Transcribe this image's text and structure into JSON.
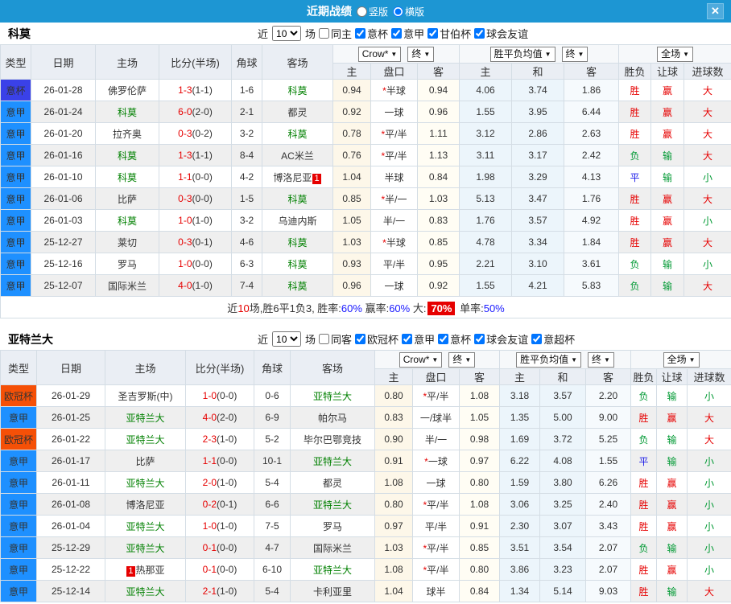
{
  "titlebar": {
    "title": "近期战绩",
    "options": [
      {
        "label": "竖版",
        "selected": false
      },
      {
        "label": "横版",
        "selected": true
      }
    ],
    "close_label": "✕"
  },
  "table": {
    "left_headers": [
      "类型",
      "日期",
      "主场",
      "比分(半场)",
      "角球",
      "客场"
    ],
    "sub_headers": [
      "主",
      "盘口",
      "客",
      "主",
      "和",
      "客",
      "胜负",
      "让球",
      "进球数"
    ],
    "dropdowns": {
      "odds": [
        "Crow*",
        "终"
      ],
      "avg": [
        "胜平负均值",
        "终"
      ],
      "scope": [
        "全场"
      ]
    }
  },
  "colors": {
    "titlebar_bg": "#1d96d3",
    "league": {
      "意甲": "#1e90ff",
      "意杯": "#3a41e8",
      "欧冠杯": "#f55007"
    },
    "outcome": {
      "胜": "#e60000",
      "平": "#1a1ae8",
      "负": "#009933",
      "赢": "#e60000",
      "输": "#009933",
      "大": "#e60000",
      "小": "#009933"
    }
  },
  "sections": [
    {
      "team": "科莫",
      "filter": {
        "prefix": "近",
        "count": "10",
        "suffix": "场",
        "toggle": {
          "label": "同主",
          "checked": false
        },
        "leagues": [
          {
            "label": "意杯",
            "checked": true
          },
          {
            "label": "意甲",
            "checked": true
          },
          {
            "label": "甘伯杯",
            "checked": true
          },
          {
            "label": "球会友谊",
            "checked": true
          }
        ]
      },
      "rows": [
        {
          "league": "意杯",
          "date": "26-01-28",
          "home": {
            "name": "佛罗伦萨"
          },
          "score": "1-3",
          "half": "(1-1)",
          "corners": "1-6",
          "away": {
            "name": "科莫",
            "focus": true
          },
          "odds": [
            "0.94",
            "*半球",
            "0.94"
          ],
          "avg": [
            "4.06",
            "3.74",
            "1.86"
          ],
          "outcome": [
            "胜",
            "赢",
            "大"
          ]
        },
        {
          "league": "意甲",
          "date": "26-01-24",
          "home": {
            "name": "科莫",
            "focus": true
          },
          "score": "6-0",
          "half": "(2-0)",
          "corners": "2-1",
          "away": {
            "name": "都灵"
          },
          "odds": [
            "0.92",
            "一球",
            "0.96"
          ],
          "avg": [
            "1.55",
            "3.95",
            "6.44"
          ],
          "outcome": [
            "胜",
            "赢",
            "大"
          ]
        },
        {
          "league": "意甲",
          "date": "26-01-20",
          "home": {
            "name": "拉齐奥"
          },
          "score": "0-3",
          "half": "(0-2)",
          "corners": "3-2",
          "away": {
            "name": "科莫",
            "focus": true
          },
          "odds": [
            "0.78",
            "*平/半",
            "1.11"
          ],
          "avg": [
            "3.12",
            "2.86",
            "2.63"
          ],
          "outcome": [
            "胜",
            "赢",
            "大"
          ]
        },
        {
          "league": "意甲",
          "date": "26-01-16",
          "home": {
            "name": "科莫",
            "focus": true
          },
          "score": "1-3",
          "half": "(1-1)",
          "corners": "8-4",
          "away": {
            "name": "AC米兰"
          },
          "odds": [
            "0.76",
            "*平/半",
            "1.13"
          ],
          "avg": [
            "3.11",
            "3.17",
            "2.42"
          ],
          "outcome": [
            "负",
            "输",
            "大"
          ]
        },
        {
          "league": "意甲",
          "date": "26-01-10",
          "home": {
            "name": "科莫",
            "focus": true
          },
          "score": "1-1",
          "half": "(0-0)",
          "corners": "4-2",
          "away": {
            "name": "博洛尼亚",
            "badge": "1",
            "badge_pos": "after"
          },
          "odds": [
            "1.04",
            "半球",
            "0.84"
          ],
          "avg": [
            "1.98",
            "3.29",
            "4.13"
          ],
          "outcome": [
            "平",
            "输",
            "小"
          ]
        },
        {
          "league": "意甲",
          "date": "26-01-06",
          "home": {
            "name": "比萨"
          },
          "score": "0-3",
          "half": "(0-0)",
          "corners": "1-5",
          "away": {
            "name": "科莫",
            "focus": true
          },
          "odds": [
            "0.85",
            "*半/一",
            "1.03"
          ],
          "avg": [
            "5.13",
            "3.47",
            "1.76"
          ],
          "outcome": [
            "胜",
            "赢",
            "大"
          ]
        },
        {
          "league": "意甲",
          "date": "26-01-03",
          "home": {
            "name": "科莫",
            "focus": true
          },
          "score": "1-0",
          "half": "(1-0)",
          "corners": "3-2",
          "away": {
            "name": "乌迪内斯"
          },
          "odds": [
            "1.05",
            "半/一",
            "0.83"
          ],
          "avg": [
            "1.76",
            "3.57",
            "4.92"
          ],
          "outcome": [
            "胜",
            "赢",
            "小"
          ]
        },
        {
          "league": "意甲",
          "date": "25-12-27",
          "home": {
            "name": "莱切"
          },
          "score": "0-3",
          "half": "(0-1)",
          "corners": "4-6",
          "away": {
            "name": "科莫",
            "focus": true
          },
          "odds": [
            "1.03",
            "*半球",
            "0.85"
          ],
          "avg": [
            "4.78",
            "3.34",
            "1.84"
          ],
          "outcome": [
            "胜",
            "赢",
            "大"
          ]
        },
        {
          "league": "意甲",
          "date": "25-12-16",
          "home": {
            "name": "罗马"
          },
          "score": "1-0",
          "half": "(0-0)",
          "corners": "6-3",
          "away": {
            "name": "科莫",
            "focus": true
          },
          "odds": [
            "0.93",
            "平/半",
            "0.95"
          ],
          "avg": [
            "2.21",
            "3.10",
            "3.61"
          ],
          "outcome": [
            "负",
            "输",
            "小"
          ]
        },
        {
          "league": "意甲",
          "date": "25-12-07",
          "home": {
            "name": "国际米兰"
          },
          "score": "4-0",
          "half": "(1-0)",
          "corners": "7-4",
          "away": {
            "name": "科莫",
            "focus": true
          },
          "odds": [
            "0.96",
            "一球",
            "0.92"
          ],
          "avg": [
            "1.55",
            "4.21",
            "5.83"
          ],
          "outcome": [
            "负",
            "输",
            "大"
          ]
        }
      ],
      "summary": [
        {
          "t": "近"
        },
        {
          "t": "10",
          "c": "red"
        },
        {
          "t": "场,胜6平1负3, 胜率:"
        },
        {
          "t": "60%",
          "c": "blue"
        },
        {
          "t": " 赢率:"
        },
        {
          "t": "60%",
          "c": "blue"
        },
        {
          "t": " 大:"
        },
        {
          "t": "70%",
          "c": "hl"
        },
        {
          "t": " 单率:"
        },
        {
          "t": "50%",
          "c": "blue"
        }
      ]
    },
    {
      "team": "亚特兰大",
      "filter": {
        "prefix": "近",
        "count": "10",
        "suffix": "场",
        "toggle": {
          "label": "同客",
          "checked": false
        },
        "leagues": [
          {
            "label": "欧冠杯",
            "checked": true
          },
          {
            "label": "意甲",
            "checked": true
          },
          {
            "label": "意杯",
            "checked": true
          },
          {
            "label": "球会友谊",
            "checked": true
          },
          {
            "label": "意超杯",
            "checked": true
          }
        ]
      },
      "rows": [
        {
          "league": "欧冠杯",
          "date": "26-01-29",
          "home": {
            "name": "圣吉罗斯(中)"
          },
          "score": "1-0",
          "half": "(0-0)",
          "corners": "0-6",
          "away": {
            "name": "亚特兰大",
            "focus": true
          },
          "odds": [
            "0.80",
            "*平/半",
            "1.08"
          ],
          "avg": [
            "3.18",
            "3.57",
            "2.20"
          ],
          "outcome": [
            "负",
            "输",
            "小"
          ]
        },
        {
          "league": "意甲",
          "date": "26-01-25",
          "home": {
            "name": "亚特兰大",
            "focus": true
          },
          "score": "4-0",
          "half": "(2-0)",
          "corners": "6-9",
          "away": {
            "name": "帕尔马"
          },
          "odds": [
            "0.83",
            "一/球半",
            "1.05"
          ],
          "avg": [
            "1.35",
            "5.00",
            "9.00"
          ],
          "outcome": [
            "胜",
            "赢",
            "大"
          ]
        },
        {
          "league": "欧冠杯",
          "date": "26-01-22",
          "home": {
            "name": "亚特兰大",
            "focus": true
          },
          "score": "2-3",
          "half": "(1-0)",
          "corners": "5-2",
          "away": {
            "name": "毕尔巴鄂竞技"
          },
          "odds": [
            "0.90",
            "半/一",
            "0.98"
          ],
          "avg": [
            "1.69",
            "3.72",
            "5.25"
          ],
          "outcome": [
            "负",
            "输",
            "大"
          ]
        },
        {
          "league": "意甲",
          "date": "26-01-17",
          "home": {
            "name": "比萨"
          },
          "score": "1-1",
          "half": "(0-0)",
          "corners": "10-1",
          "away": {
            "name": "亚特兰大",
            "focus": true
          },
          "odds": [
            "0.91",
            "*一球",
            "0.97"
          ],
          "avg": [
            "6.22",
            "4.08",
            "1.55"
          ],
          "outcome": [
            "平",
            "输",
            "小"
          ]
        },
        {
          "league": "意甲",
          "date": "26-01-11",
          "home": {
            "name": "亚特兰大",
            "focus": true
          },
          "score": "2-0",
          "half": "(1-0)",
          "corners": "5-4",
          "away": {
            "name": "都灵"
          },
          "odds": [
            "1.08",
            "一球",
            "0.80"
          ],
          "avg": [
            "1.59",
            "3.80",
            "6.26"
          ],
          "outcome": [
            "胜",
            "赢",
            "小"
          ]
        },
        {
          "league": "意甲",
          "date": "26-01-08",
          "home": {
            "name": "博洛尼亚"
          },
          "score": "0-2",
          "half": "(0-1)",
          "corners": "6-6",
          "away": {
            "name": "亚特兰大",
            "focus": true
          },
          "odds": [
            "0.80",
            "*平/半",
            "1.08"
          ],
          "avg": [
            "3.06",
            "3.25",
            "2.40"
          ],
          "outcome": [
            "胜",
            "赢",
            "小"
          ]
        },
        {
          "league": "意甲",
          "date": "26-01-04",
          "home": {
            "name": "亚特兰大",
            "focus": true
          },
          "score": "1-0",
          "half": "(1-0)",
          "corners": "7-5",
          "away": {
            "name": "罗马"
          },
          "odds": [
            "0.97",
            "平/半",
            "0.91"
          ],
          "avg": [
            "2.30",
            "3.07",
            "3.43"
          ],
          "outcome": [
            "胜",
            "赢",
            "小"
          ]
        },
        {
          "league": "意甲",
          "date": "25-12-29",
          "home": {
            "name": "亚特兰大",
            "focus": true
          },
          "score": "0-1",
          "half": "(0-0)",
          "corners": "4-7",
          "away": {
            "name": "国际米兰"
          },
          "odds": [
            "1.03",
            "*平/半",
            "0.85"
          ],
          "avg": [
            "3.51",
            "3.54",
            "2.07"
          ],
          "outcome": [
            "负",
            "输",
            "小"
          ]
        },
        {
          "league": "意甲",
          "date": "25-12-22",
          "home": {
            "name": "热那亚",
            "badge": "1",
            "badge_pos": "before"
          },
          "score": "0-1",
          "half": "(0-0)",
          "corners": "6-10",
          "away": {
            "name": "亚特兰大",
            "focus": true
          },
          "odds": [
            "1.08",
            "*平/半",
            "0.80"
          ],
          "avg": [
            "3.86",
            "3.23",
            "2.07"
          ],
          "outcome": [
            "胜",
            "赢",
            "小"
          ]
        },
        {
          "league": "意甲",
          "date": "25-12-14",
          "home": {
            "name": "亚特兰大",
            "focus": true
          },
          "score": "2-1",
          "half": "(1-0)",
          "corners": "5-4",
          "away": {
            "name": "卡利亚里"
          },
          "odds": [
            "1.04",
            "球半",
            "0.84"
          ],
          "avg": [
            "1.34",
            "5.14",
            "9.03"
          ],
          "outcome": [
            "胜",
            "输",
            "大"
          ]
        }
      ],
      "summary": null
    }
  ]
}
